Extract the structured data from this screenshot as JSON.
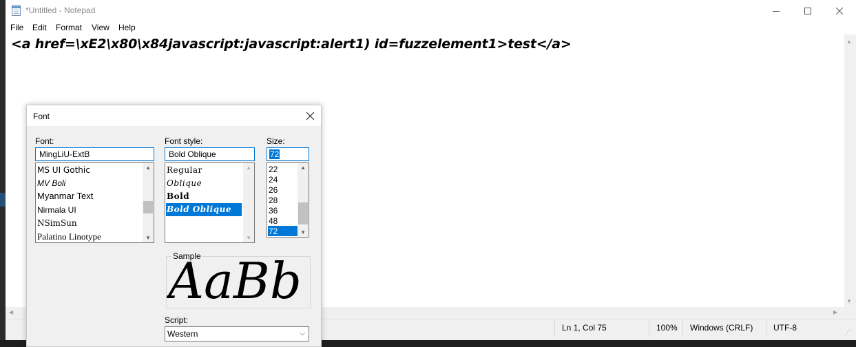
{
  "window": {
    "title": "*Untitled - Notepad"
  },
  "menu": [
    "File",
    "Edit",
    "Format",
    "View",
    "Help"
  ],
  "editor": {
    "content": "<a href=\\xE2\\x80\\x84javascript:javascript:alert1) id=fuzzelement1>test</a>"
  },
  "status": {
    "position": "Ln 1, Col 75",
    "zoom": "100%",
    "line_ending": "Windows (CRLF)",
    "encoding": "UTF-8"
  },
  "font_dialog": {
    "title": "Font",
    "font_label": "Font:",
    "font_value": "MingLiU-ExtB",
    "font_list": [
      "MS UI Gothic",
      "MV Boli",
      "Myanmar Text",
      "Nirmala UI",
      "NSimSun",
      "Palatino Linotype"
    ],
    "style_label": "Font style:",
    "style_value": "Bold Oblique",
    "style_list": [
      "Regular",
      "Oblique",
      "Bold",
      "Bold Oblique"
    ],
    "size_label": "Size:",
    "size_value": "72",
    "size_list": [
      "22",
      "24",
      "26",
      "28",
      "36",
      "48",
      "72"
    ],
    "sample_label": "Sample",
    "sample_text": "AaBb",
    "script_label": "Script:",
    "script_value": "Western"
  },
  "colors": {
    "accent": "#0078d7",
    "chrome": "#f0f0f0",
    "title_text": "#8a8a8a"
  },
  "icons": {
    "app": "notepad-icon",
    "minimize": "minimize-icon",
    "maximize": "maximize-icon",
    "close": "close-icon",
    "chevron": "chevron-down-icon"
  }
}
